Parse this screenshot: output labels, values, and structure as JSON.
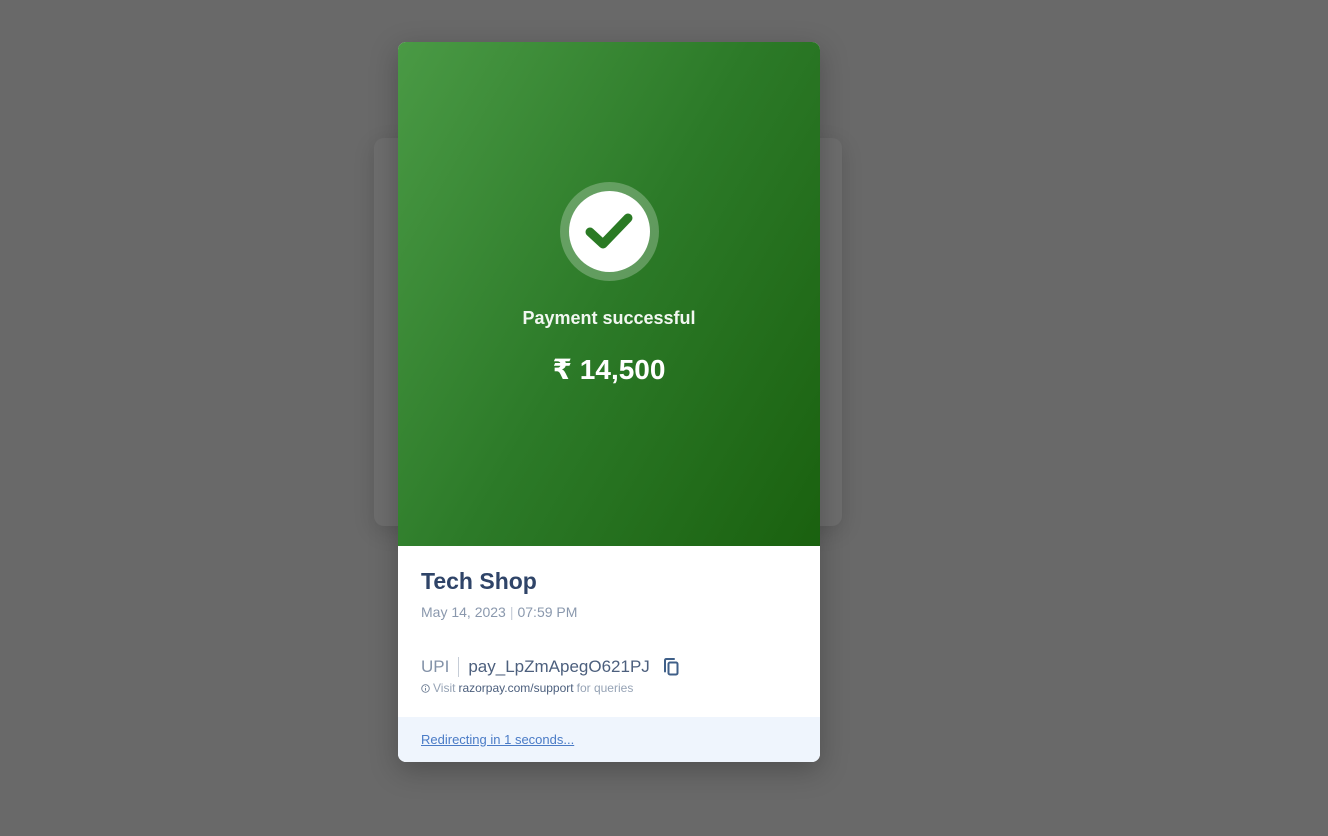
{
  "payment": {
    "status": "Payment successful",
    "amount": "₹ 14,500"
  },
  "merchant": {
    "name": "Tech Shop",
    "date": "May 14, 2023",
    "time": "07:59 PM"
  },
  "transaction": {
    "method": "UPI",
    "payment_id": "pay_LpZmApegO621PJ"
  },
  "support": {
    "prefix": "Visit",
    "link": "razorpay.com/support",
    "suffix": "for queries"
  },
  "footer": {
    "redirect_text": "Redirecting in 1 seconds..."
  },
  "icons": {
    "success": "check-icon",
    "copy": "copy-icon",
    "info": "info-icon"
  },
  "colors": {
    "hero_gradient_start": "#4a9a45",
    "hero_gradient_end": "#1a610f",
    "check_mark": "#2a7a24",
    "overlay_background": "#696969",
    "footer_background": "#eff5fd",
    "link": "#4a7bc6"
  }
}
